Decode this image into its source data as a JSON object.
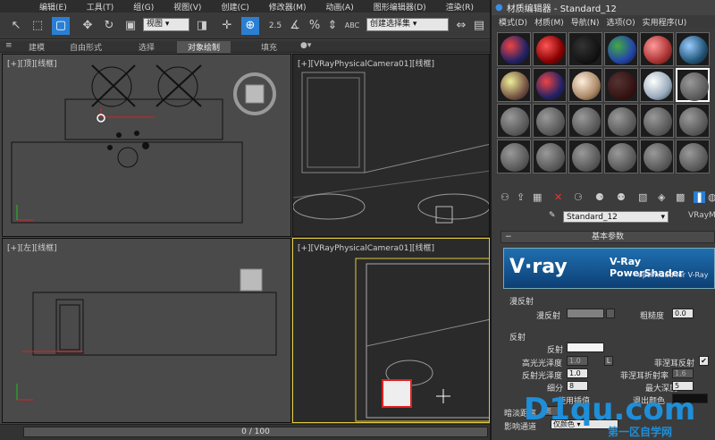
{
  "menubar": {
    "items": [
      "编辑(E)",
      "工具(T)",
      "组(G)",
      "视图(V)",
      "创建(C)",
      "修改器(M)",
      "动画(A)",
      "图形编辑器(D)",
      "渲染(R)",
      "自"
    ]
  },
  "toolbar": {
    "view_select": "视图",
    "snap_value": "2.5",
    "selection_set_placeholder": "创建选择集"
  },
  "ribbon": {
    "tabs": [
      "建模",
      "自由形式",
      "选择",
      "对象绘制",
      "填充"
    ]
  },
  "viewports": {
    "top": "[+][顶][线框]",
    "camera_top_right": "[+][VRayPhysicalCamera01][线框]",
    "front": "[+][左][线框]",
    "camera_bottom_right": "[+][VRayPhysicalCamera01][线框]"
  },
  "status": {
    "timeline": "0 / 100"
  },
  "material_editor": {
    "title": "材质编辑器 - Standard_12",
    "menu": [
      "模式(D)",
      "材质(M)",
      "导航(N)",
      "选项(O)",
      "实用程序(U)"
    ],
    "material_name": "Standard_12",
    "material_type": "VRayMtl",
    "basic_params_header": "基本参数",
    "banner_logo": "V·ray",
    "banner_title": "V-Ray PowerShader",
    "banner_subtitle": "optimized for V-Ray",
    "diffuse_group": "漫反射",
    "diffuse_label": "漫反射",
    "roughness_label": "粗糙度",
    "roughness_value": "0.0",
    "reflect_group": "反射",
    "reflect_label": "反射",
    "hilight_gloss_label": "高光光泽度",
    "hilight_gloss_value": "1.0",
    "lock_label": "L",
    "fresnel_label": "菲涅耳反射",
    "refl_gloss_label": "反射光泽度",
    "refl_gloss_value": "1.0",
    "fresnel_ior_label": "菲涅耳折射率",
    "fresnel_ior_value": "1.6",
    "subdivs_label": "细分",
    "subdivs_value": "8",
    "max_depth_label": "最大深度",
    "max_depth_value": "5",
    "use_interp_label": "使用插值",
    "exit_color_label": "退出颜色",
    "dim_dist_label": "暗淡距离",
    "dim_dist_value": "离",
    "affect_channels_label": "影响通道",
    "affect_channels_value": "仅颜色"
  },
  "watermark": {
    "logo": "D1qu.com",
    "subtitle": "第一区自学网"
  },
  "colors": {
    "accent_blue": "#2a7fd4",
    "viewport_active_border": "#e0c840",
    "selection_red": "#e02020"
  }
}
